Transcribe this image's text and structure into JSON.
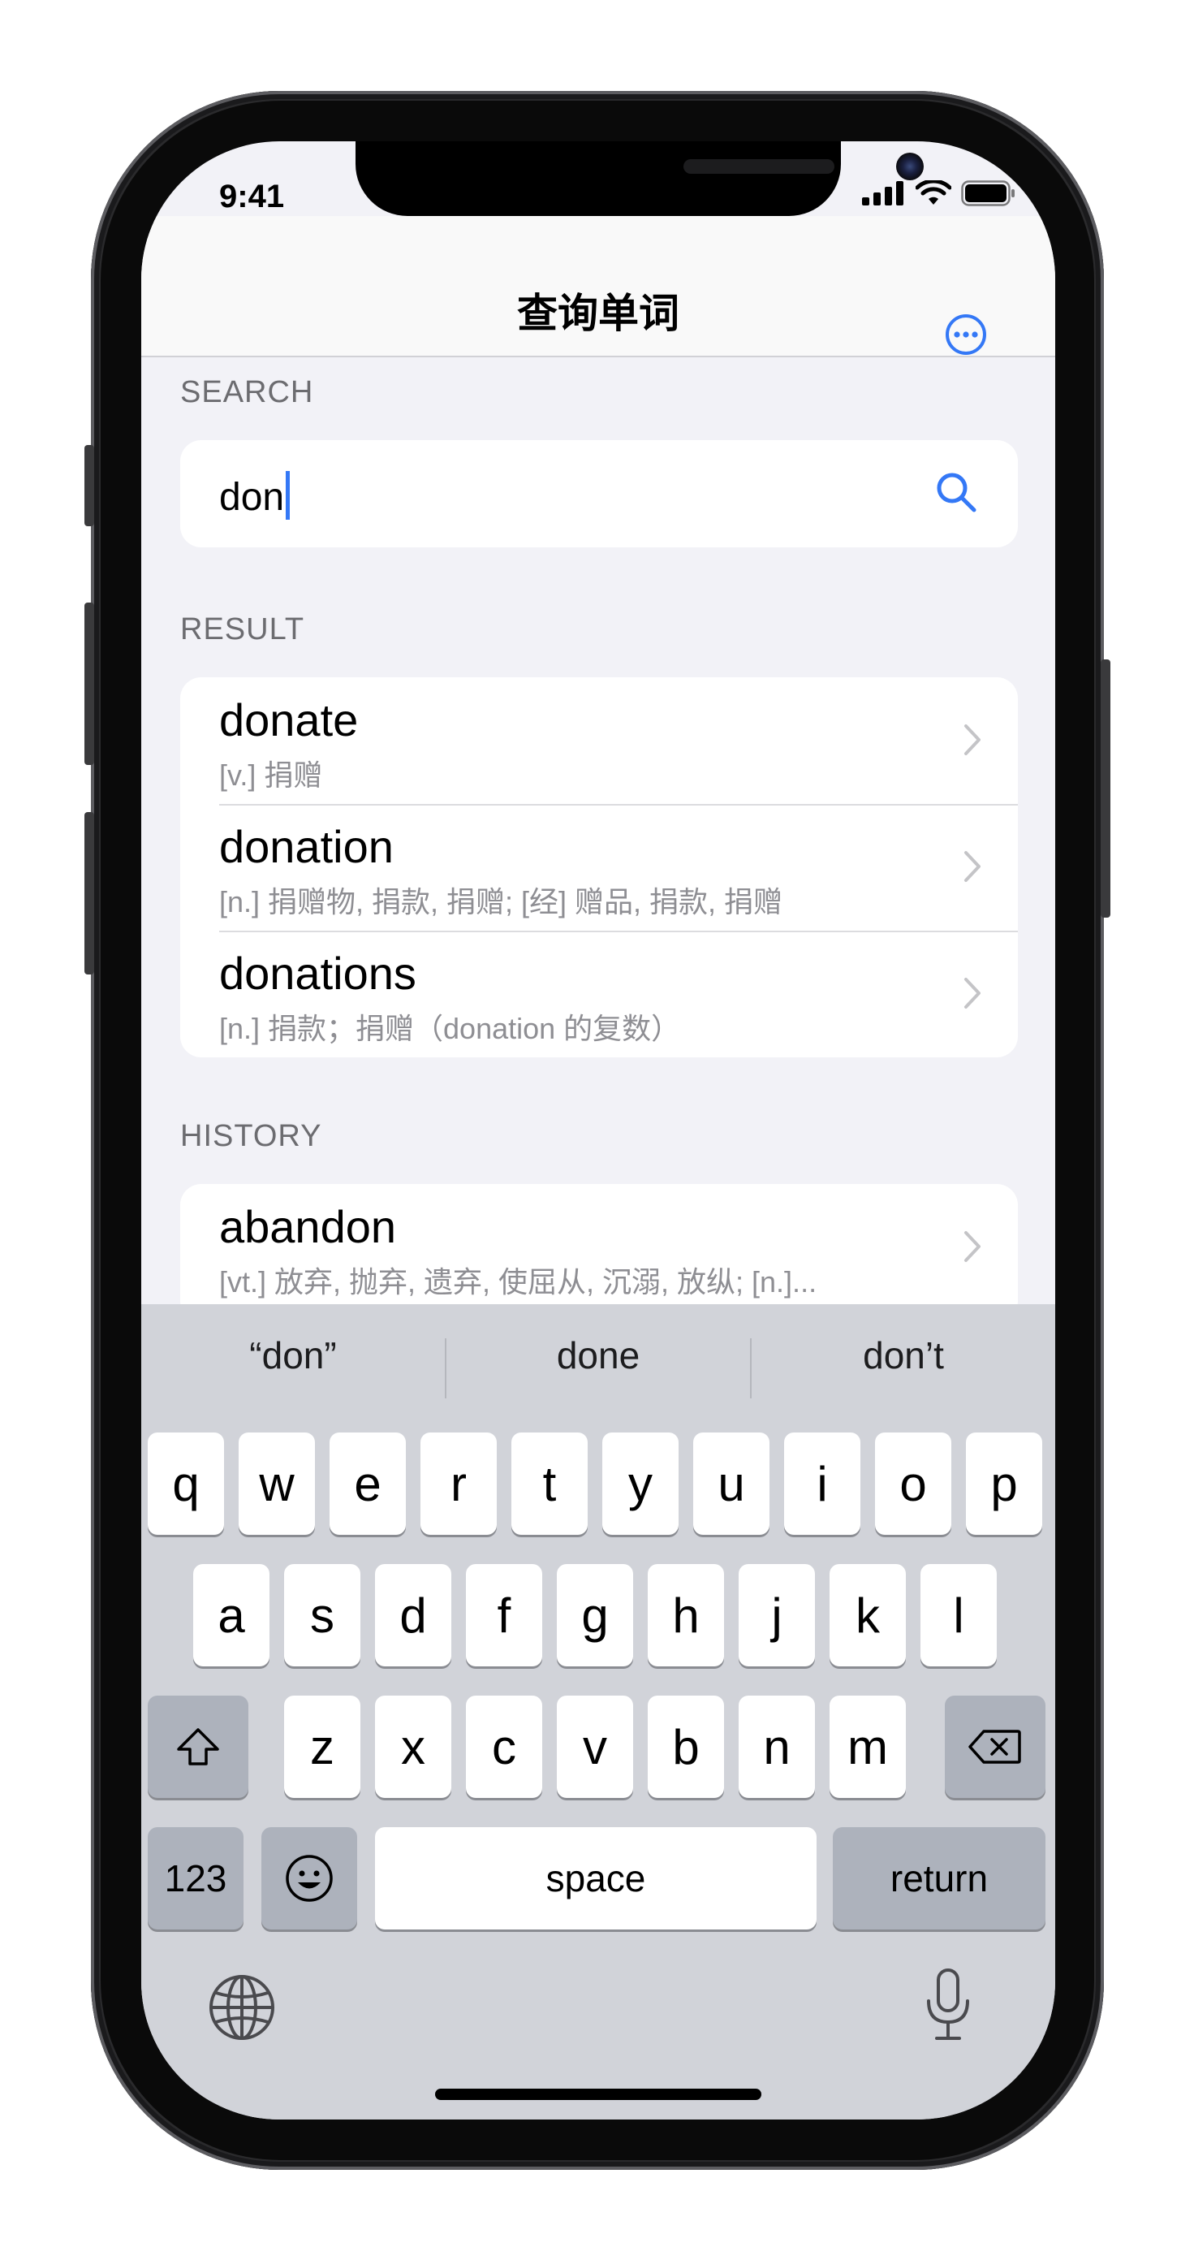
{
  "status_bar": {
    "time": "9:41"
  },
  "nav": {
    "title": "查询单词"
  },
  "search": {
    "section_label": "SEARCH",
    "value": "don"
  },
  "results": {
    "section_label": "RESULT",
    "items": [
      {
        "word": "donate",
        "definition": "[v.]  捐赠"
      },
      {
        "word": "donation",
        "definition": "[n.]  捐赠物, 捐款, 捐赠; [经] 赠品, 捐款, 捐赠"
      },
      {
        "word": "donations",
        "definition": "[n.]  捐款；捐赠（donation 的复数）"
      }
    ]
  },
  "history": {
    "section_label": "HISTORY",
    "items": [
      {
        "word": "abandon",
        "definition": "[vt.]  放弃, 抛弃, 遗弃, 使屈从, 沉溺, 放纵; [n.]..."
      }
    ]
  },
  "keyboard": {
    "suggestions": [
      "“don”",
      "done",
      "don’t"
    ],
    "row1": [
      "q",
      "w",
      "e",
      "r",
      "t",
      "y",
      "u",
      "i",
      "o",
      "p"
    ],
    "row2": [
      "a",
      "s",
      "d",
      "f",
      "g",
      "h",
      "j",
      "k",
      "l"
    ],
    "row3": [
      "z",
      "x",
      "c",
      "v",
      "b",
      "n",
      "m"
    ],
    "numbers_key": "123",
    "space_key": "space",
    "return_key": "return",
    "icons": [
      "shift-icon",
      "delete-icon",
      "emoji-icon",
      "globe-icon",
      "microphone-icon"
    ]
  },
  "colors": {
    "accent": "#3478f6",
    "background": "#f2f2f7",
    "keyboard": "#d1d3d9"
  }
}
